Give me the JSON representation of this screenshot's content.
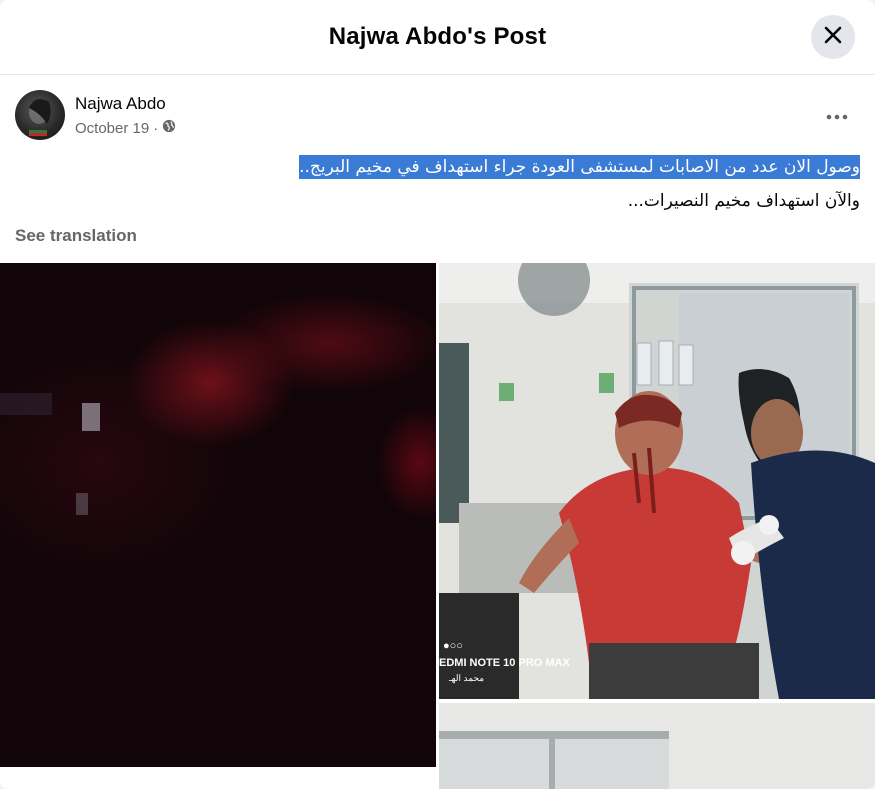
{
  "dialog": {
    "title": "Najwa Abdo's Post",
    "close_icon": "close-icon"
  },
  "post": {
    "author": "Najwa Abdo",
    "date": "October 19",
    "separator": "·",
    "privacy_icon": "globe-icon",
    "more_icon": "more-horizontal-icon",
    "text_line_1": "وصول الان عدد من الاصابات لمستشفى العودة جراء استهداف في مخيم البريج..",
    "text_line_2": "والآن استهداف مخيم النصيرات...",
    "see_translation": "See translation"
  },
  "photos": {
    "watermark": "EDMI NOTE 10 PRO MAX",
    "watermark_arabic": "محمد الهـ"
  }
}
